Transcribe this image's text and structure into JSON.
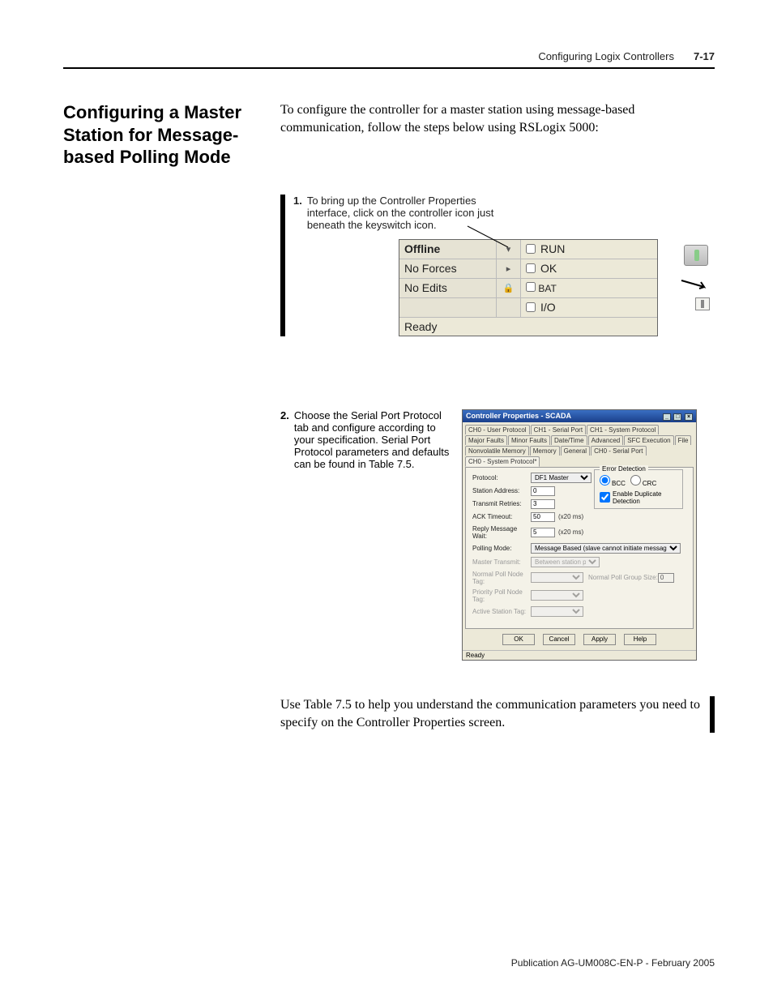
{
  "header": {
    "section": "Configuring Logix Controllers",
    "pagenum": "7-17"
  },
  "title": "Configuring a Master Station for Message-based Polling Mode",
  "intro": "To configure the controller for a master station using message-based communication, follow the steps below using RSLogix 5000:",
  "step1": {
    "num": "1.",
    "text": "To bring up the Controller Properties interface, click on the controller icon just beneath the keyswitch icon."
  },
  "statusbar": {
    "offline": "Offline",
    "noforces": "No Forces",
    "noedits": "No Edits",
    "run": "RUN",
    "ok": "OK",
    "bat": "BAT",
    "io": "I/O",
    "ready": "Ready"
  },
  "step2": {
    "num": "2.",
    "text": "Choose the Serial Port Protocol tab and configure according to your specification. Serial Port Protocol parameters and defaults can be found in Table 7.5."
  },
  "dialog": {
    "title": "Controller Properties - SCADA",
    "tabs_row1": [
      "CH0 - User Protocol",
      "CH1 - Serial Port",
      "CH1 - System Protocol",
      "Major Faults",
      "Minor Faults"
    ],
    "tabs_row2": [
      "Date/Time",
      "Advanced",
      "SFC Execution",
      "File",
      "Nonvolatile Memory",
      "Memory"
    ],
    "tabs_row3": [
      "General",
      "CH0 - Serial Port",
      "CH0 - System Protocol*"
    ],
    "fields": {
      "protocol_lbl": "Protocol:",
      "protocol_val": "DF1 Master",
      "station_lbl": "Station Address:",
      "station_val": "0",
      "retries_lbl": "Transmit Retries:",
      "retries_val": "3",
      "ack_lbl": "ACK Timeout:",
      "ack_val": "50",
      "ack_unit": "(x20 ms)",
      "reply_lbl": "Reply Message Wait:",
      "reply_val": "5",
      "reply_unit": "(x20 ms)",
      "polling_lbl": "Polling Mode:",
      "polling_val": "Message Based (slave cannot initiate messages)",
      "master_lbl": "Master Transmit:",
      "master_val": "Between station polls",
      "normal_lbl": "Normal Poll Node Tag:",
      "normal_group_lbl": "Normal Poll Group Size:",
      "normal_group_val": "0",
      "priority_lbl": "Priority Poll Node Tag:",
      "active_lbl": "Active Station Tag:"
    },
    "errorbox": {
      "legend": "Error Detection",
      "bcc": "BCC",
      "crc": "CRC",
      "dup": "Enable Duplicate Detection"
    },
    "buttons": {
      "ok": "OK",
      "cancel": "Cancel",
      "apply": "Apply",
      "help": "Help"
    },
    "status": "Ready"
  },
  "footnote": "Use Table 7.5 to help you understand the communication parameters you need to specify on the Controller Properties screen.",
  "publication": "Publication AG-UM008C-EN-P - February 2005"
}
